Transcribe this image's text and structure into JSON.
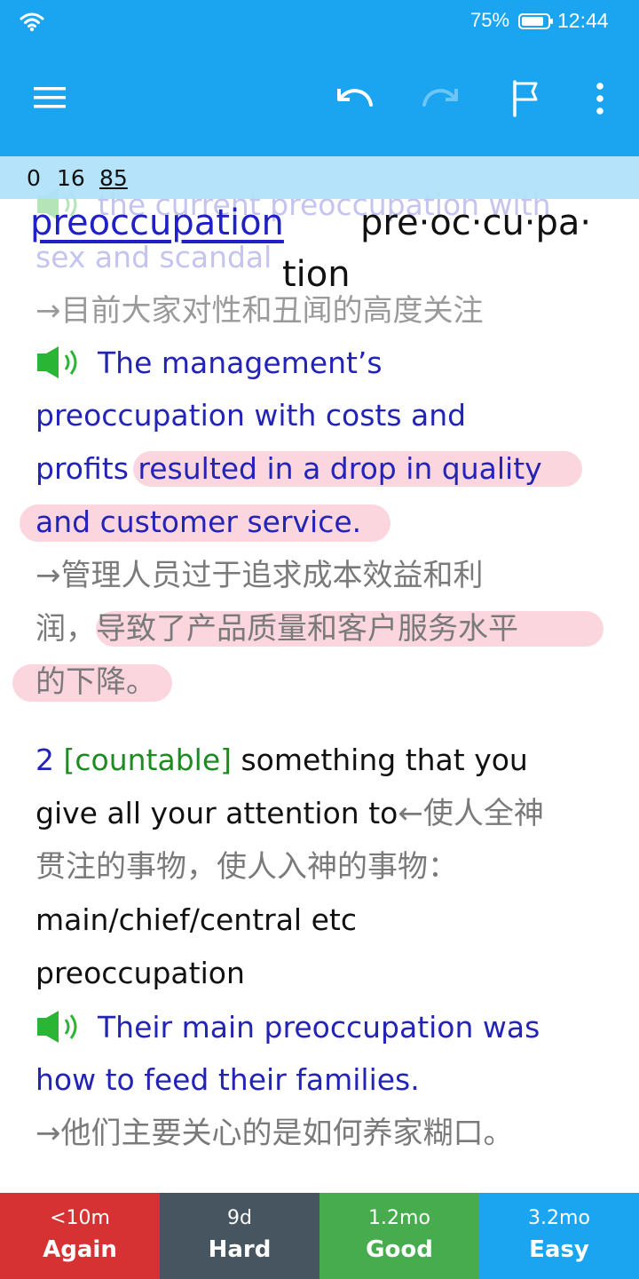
{
  "status_bar": {
    "battery_percent": "75%",
    "time": "12:44",
    "icons": [
      "wifi-icon",
      "battery-icon"
    ]
  },
  "toolbar": {
    "icons": [
      "menu-icon",
      "undo-icon",
      "redo-icon",
      "flag-icon",
      "more-vertical-icon"
    ]
  },
  "counts": {
    "new": "0",
    "learning": "16",
    "review": "85"
  },
  "card": {
    "faded_example_en": "the current preoccupation with",
    "faded_example_en_2": "sex and scandal",
    "faded_example_cn": "→目前大家对性和丑闻的高度关注",
    "headword": "preoccupation",
    "syllabification_1": "pre·oc·cu·pa·",
    "syllabification_2": "tion",
    "example1_line1": "The management’s",
    "example1_line2": "preoccupation with costs and",
    "example1_line3_a": "profits",
    "example1_line3_b": " resulted in a drop in quality",
    "example1_line4": "and customer service.",
    "example1_cn_line1": "→管理人员过于追求成本效益和利",
    "example1_cn_line2_a": "润，",
    "example1_cn_line2_b": "导致了产品质量和客户服务水平",
    "example1_cn_line3": "的下降。",
    "sense2_number": "2",
    "sense2_tag": "[countable]",
    "sense2_def_a": " something that you",
    "sense2_def_b": "give all your attention to",
    "sense2_cn_a": "←使人全神",
    "sense2_cn_b": "贯注的事物，使人入神的事物：",
    "collocation_1": "main/chief/central etc",
    "collocation_2": "preoccupation",
    "example2_line1": "Their main preoccupation was",
    "example2_line2": "how to feed their families.",
    "example2_cn": "→他们主要关心的是如何养家糊口。"
  },
  "answers": [
    {
      "interval": "<10m",
      "label": "Again",
      "color": "#d63233"
    },
    {
      "interval": "9d",
      "label": "Hard",
      "color": "#46555f"
    },
    {
      "interval": "1.2mo",
      "label": "Good",
      "color": "#46ac4e"
    },
    {
      "interval": "3.2mo",
      "label": "Easy",
      "color": "#1ba4ef"
    }
  ]
}
